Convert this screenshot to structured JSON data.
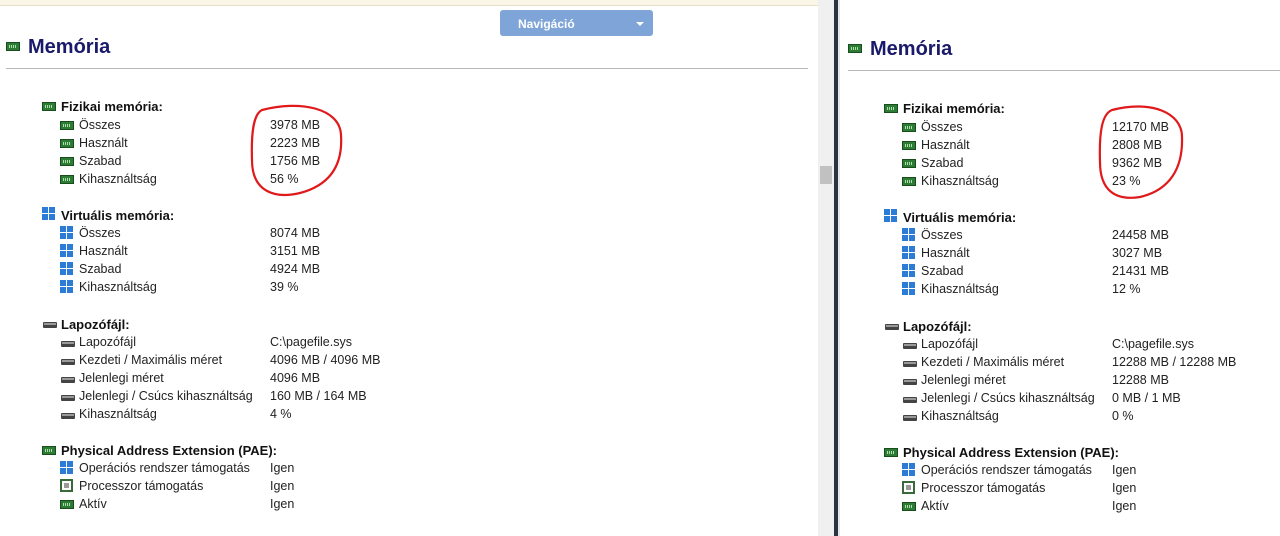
{
  "navigation": {
    "label": "Navigáció",
    "icon": "caret-down-icon"
  },
  "accent_color": "#1a1a6b",
  "annotation_color": "#e0191b",
  "left": {
    "title": "Memória",
    "physical": {
      "header": "Fizikai memória:",
      "rows": [
        {
          "label": "Összes",
          "value": "3978 MB"
        },
        {
          "label": "Használt",
          "value": "2223 MB"
        },
        {
          "label": "Szabad",
          "value": "1756 MB"
        },
        {
          "label": "Kihasználtság",
          "value": "56 %"
        }
      ]
    },
    "virtual": {
      "header": "Virtuális memória:",
      "rows": [
        {
          "label": "Összes",
          "value": "8074 MB"
        },
        {
          "label": "Használt",
          "value": "3151 MB"
        },
        {
          "label": "Szabad",
          "value": "4924 MB"
        },
        {
          "label": "Kihasználtság",
          "value": "39 %"
        }
      ]
    },
    "pagefile": {
      "header": "Lapozófájl:",
      "rows": [
        {
          "label": "Lapozófájl",
          "value": "C:\\pagefile.sys"
        },
        {
          "label": "Kezdeti / Maximális méret",
          "value": "4096 MB / 4096 MB"
        },
        {
          "label": "Jelenlegi méret",
          "value": "4096 MB"
        },
        {
          "label": "Jelenlegi / Csúcs kihasználtság",
          "value": "160 MB / 164 MB"
        },
        {
          "label": "Kihasználtság",
          "value": "4 %"
        }
      ]
    },
    "pae": {
      "header": "Physical Address Extension (PAE):",
      "rows": [
        {
          "label": "Operációs rendszer támogatás",
          "value": "Igen"
        },
        {
          "label": "Processzor támogatás",
          "value": "Igen"
        },
        {
          "label": "Aktív",
          "value": "Igen"
        }
      ]
    }
  },
  "right": {
    "title": "Memória",
    "physical": {
      "header": "Fizikai memória:",
      "rows": [
        {
          "label": "Összes",
          "value": "12170 MB"
        },
        {
          "label": "Használt",
          "value": "2808 MB"
        },
        {
          "label": "Szabad",
          "value": "9362 MB"
        },
        {
          "label": "Kihasználtság",
          "value": "23 %"
        }
      ]
    },
    "virtual": {
      "header": "Virtuális memória:",
      "rows": [
        {
          "label": "Összes",
          "value": "24458 MB"
        },
        {
          "label": "Használt",
          "value": "3027 MB"
        },
        {
          "label": "Szabad",
          "value": "21431 MB"
        },
        {
          "label": "Kihasználtság",
          "value": "12 %"
        }
      ]
    },
    "pagefile": {
      "header": "Lapozófájl:",
      "rows": [
        {
          "label": "Lapozófájl",
          "value": "C:\\pagefile.sys"
        },
        {
          "label": "Kezdeti / Maximális méret",
          "value": "12288 MB / 12288 MB"
        },
        {
          "label": "Jelenlegi méret",
          "value": "12288 MB"
        },
        {
          "label": "Jelenlegi / Csúcs kihasználtság",
          "value": "0 MB / 1 MB"
        },
        {
          "label": "Kihasználtság",
          "value": "0 %"
        }
      ]
    },
    "pae": {
      "header": "Physical Address Extension (PAE):",
      "rows": [
        {
          "label": "Operációs rendszer támogatás",
          "value": "Igen"
        },
        {
          "label": "Processzor támogatás",
          "value": "Igen"
        },
        {
          "label": "Aktív",
          "value": "Igen"
        }
      ]
    }
  }
}
